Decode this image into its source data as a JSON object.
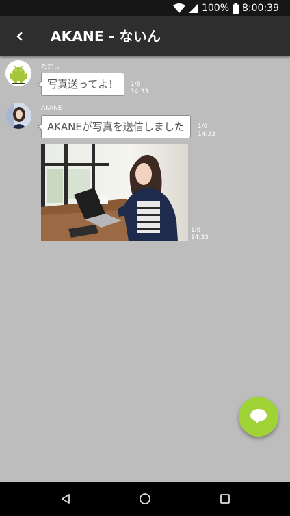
{
  "status_bar": {
    "battery_percent": "100%",
    "time": "8:00:39",
    "icons": [
      "wifi-icon",
      "signal-icon",
      "battery-icon"
    ]
  },
  "app_bar": {
    "back_icon": "chevron-left-icon",
    "title": "AKANE - ないん"
  },
  "messages": [
    {
      "sender": "たかし",
      "avatar": "android-robot-icon",
      "text": "写真送ってよ！",
      "date": "1/6",
      "time": "14:33"
    },
    {
      "sender": "AKANE",
      "avatar": "woman-portrait",
      "text": "AKANEが写真を送信しました",
      "date": "1/6",
      "time": "14:33"
    },
    {
      "sender": "AKANE",
      "type": "photo",
      "photo": "woman-with-laptop-photo",
      "date": "1/6",
      "time": "14:33"
    }
  ],
  "fab": {
    "icon": "chat-bubble-icon"
  },
  "nav_bar": {
    "icons": [
      "back-triangle-icon",
      "home-circle-icon",
      "recents-square-icon"
    ]
  },
  "colors": {
    "background": "#bdbdbd",
    "app_bar": "#2e2e2e",
    "status_bar": "#161616",
    "fab": "#a0d336",
    "android_green": "#a4c639"
  }
}
